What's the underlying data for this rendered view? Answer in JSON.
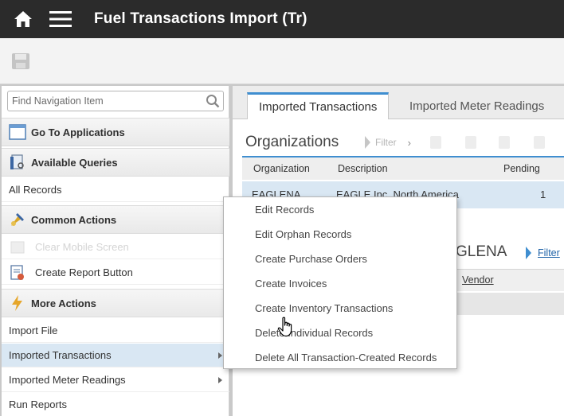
{
  "header": {
    "title": "Fuel Transactions Import (Tr)",
    "home_icon": "home-icon",
    "menu_icon": "hamburger-menu-icon"
  },
  "toolbar": {
    "save_icon": "save-icon"
  },
  "sidebar": {
    "search_placeholder": "Find Navigation Item",
    "go_to_applications": "Go To Applications",
    "available_queries": "Available Queries",
    "all_records": "All Records",
    "common_actions": "Common Actions",
    "clear_action": "Clear Mobile Screen",
    "create_report_button": "Create Report Button",
    "more_actions": "More Actions",
    "more_items": [
      {
        "label": "Import File",
        "has_submenu": false
      },
      {
        "label": "Imported Transactions",
        "has_submenu": true,
        "selected": true
      },
      {
        "label": "Imported Meter Readings",
        "has_submenu": true
      },
      {
        "label": "Run Reports",
        "has_submenu": false
      }
    ]
  },
  "main": {
    "tabs": [
      {
        "label": "Imported Transactions",
        "active": true
      },
      {
        "label": "Imported Meter Readings",
        "active": false
      }
    ],
    "organizations_title": "Organizations",
    "filter_label": "Filter",
    "columns": [
      "Organization",
      "Description",
      "Pending"
    ],
    "rows": [
      {
        "organization": "EAGLENA",
        "description": "EAGLE Inc. North America",
        "pending": "1"
      }
    ],
    "section2_title": "GLENA",
    "filter2_label": "Filter",
    "vendor_column": "Vendor"
  },
  "context_menu": {
    "items": [
      "Edit Records",
      "Edit Orphan Records",
      "Create Purchase Orders",
      "Create Invoices",
      "Create Inventory Transactions",
      "Delete Individual Records",
      "Delete All Transaction-Created Records"
    ]
  },
  "colors": {
    "header_bg": "#2b2b2b",
    "accent": "#3f8ed0",
    "selection": "#d9e7f3"
  }
}
